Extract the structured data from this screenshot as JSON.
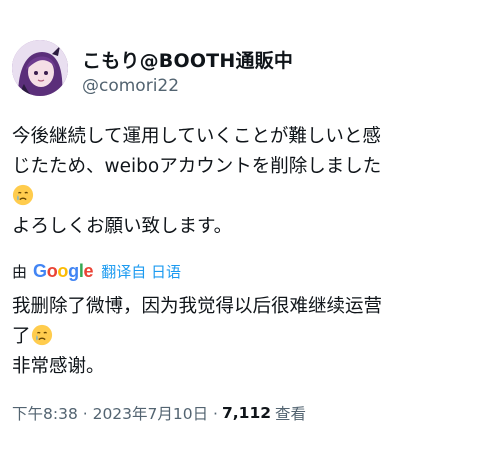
{
  "author": {
    "display_name": "こもり@BOOTH通販中",
    "handle": "@comori22"
  },
  "tweet": {
    "text_line1": "今後継続して運用していくことが難しいと感",
    "text_line2": "じたため、weiboアカウントを削除しました",
    "text_line4": "よろしくお願い致します。",
    "emoji": "crying-face-emoji"
  },
  "translation": {
    "by_label": "由",
    "google_logo": "Google",
    "link_label": "翻译自 日语",
    "text_line1": "我删除了微博，因为我觉得以后很难继续运营",
    "text_line2": "了",
    "text_line3": "非常感谢。"
  },
  "meta": {
    "timestamp": "下午8:38 · 2023年7月10日 ·",
    "views": "7,112",
    "views_label": "查看"
  },
  "colors": {
    "secondary_text": "#536471",
    "link": "#1d9bf0",
    "google": [
      "#4285f4",
      "#ea4335",
      "#fbbc05",
      "#4285f4",
      "#34a853",
      "#ea4335"
    ]
  }
}
